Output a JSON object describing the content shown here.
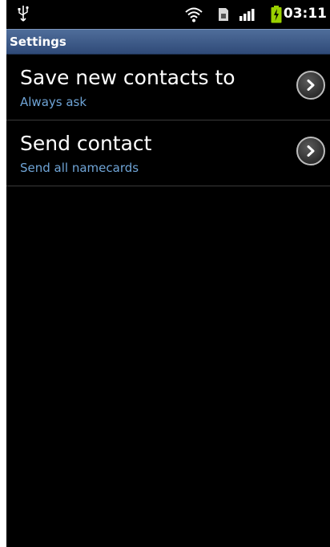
{
  "status_bar": {
    "time": "03:11",
    "icons": [
      "usb-icon",
      "wifi-icon",
      "sim-icon",
      "signal-icon",
      "battery-charging-icon"
    ]
  },
  "header": {
    "title": "Settings"
  },
  "settings": {
    "items": [
      {
        "title": "Save new contacts to",
        "subtitle": "Always ask",
        "icon": "chevron-right-icon"
      },
      {
        "title": "Send contact",
        "subtitle": "Send all namecards",
        "icon": "chevron-right-icon"
      }
    ]
  },
  "colors": {
    "background": "#000000",
    "title_bar": "#3b5a8a",
    "subtitle": "#6fa4d6",
    "battery": "#9ad000"
  }
}
